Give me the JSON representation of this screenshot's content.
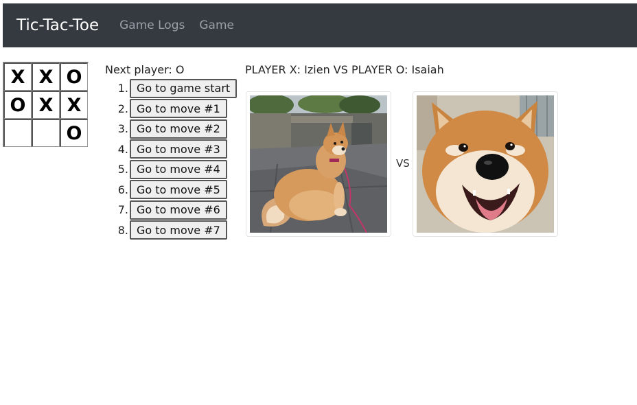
{
  "navbar": {
    "brand": "Tic-Tac-Toe",
    "links": [
      {
        "label": "Game Logs"
      },
      {
        "label": "Game"
      }
    ]
  },
  "board": {
    "squares": [
      "X",
      "X",
      "O",
      "O",
      "X",
      "X",
      "",
      "",
      "O"
    ]
  },
  "status": "Next player: O",
  "moves": [
    {
      "number": "1.",
      "label": "Go to game start"
    },
    {
      "number": "2.",
      "label": "Go to move #1"
    },
    {
      "number": "3.",
      "label": "Go to move #2"
    },
    {
      "number": "4.",
      "label": "Go to move #3"
    },
    {
      "number": "5.",
      "label": "Go to move #4"
    },
    {
      "number": "6.",
      "label": "Go to move #5"
    },
    {
      "number": "7.",
      "label": "Go to move #6"
    },
    {
      "number": "8.",
      "label": "Go to move #7"
    }
  ],
  "matchup": "PLAYER X: Izien VS PLAYER O: Isaiah",
  "vs_label": "VS",
  "colors": {
    "navbar_bg": "#343a40",
    "brand": "#ffffff",
    "nav_link": "#9aa0a6"
  }
}
